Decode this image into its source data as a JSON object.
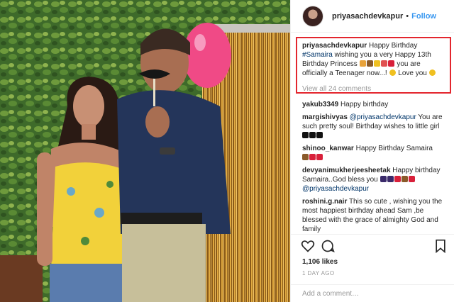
{
  "post": {
    "username": "priyasachdevkapur",
    "follow_separator": "•",
    "follow_label": "Follow",
    "caption": {
      "user": "priyasachdevkapur",
      "text_1": "Happy Birthday",
      "hashtag": "#Samaira",
      "text_2": "wishing you a very Happy 13th Birthday Princess",
      "text_3": "you are officially a Teenager now...!",
      "text_4": "Love you"
    },
    "view_all": "View all 24 comments",
    "comments": [
      {
        "user": "yakub3349",
        "parts": [
          "Happy birthday"
        ]
      },
      {
        "user": "margishivyas",
        "mention": "@priyasachdevkapur",
        "text": "You are such pretty soul! Birthday wishes to little girl"
      },
      {
        "user": "shinoo_kanwar",
        "text": "Happy Birthday Samaira"
      },
      {
        "user": "devyanimukherjeesheetak",
        "text": "Happy birthday Samaira..God bless you",
        "mention": "@priyasachdevkapur"
      },
      {
        "user": "roshini.g.nair",
        "text": "This so cute , wishing you the most happiest birthday ahead Sam ,be blessed with the grace of almighty God and family"
      }
    ],
    "likes": "1,106 likes",
    "date": "1 DAY AGO",
    "add_comment_placeholder": "Add a comment…"
  },
  "icons": {
    "like": "heart-icon",
    "comment": "comment-icon",
    "save": "bookmark-icon"
  },
  "colors": {
    "link": "#003569",
    "follow": "#3897f0",
    "highlight_border": "#e3262e"
  }
}
